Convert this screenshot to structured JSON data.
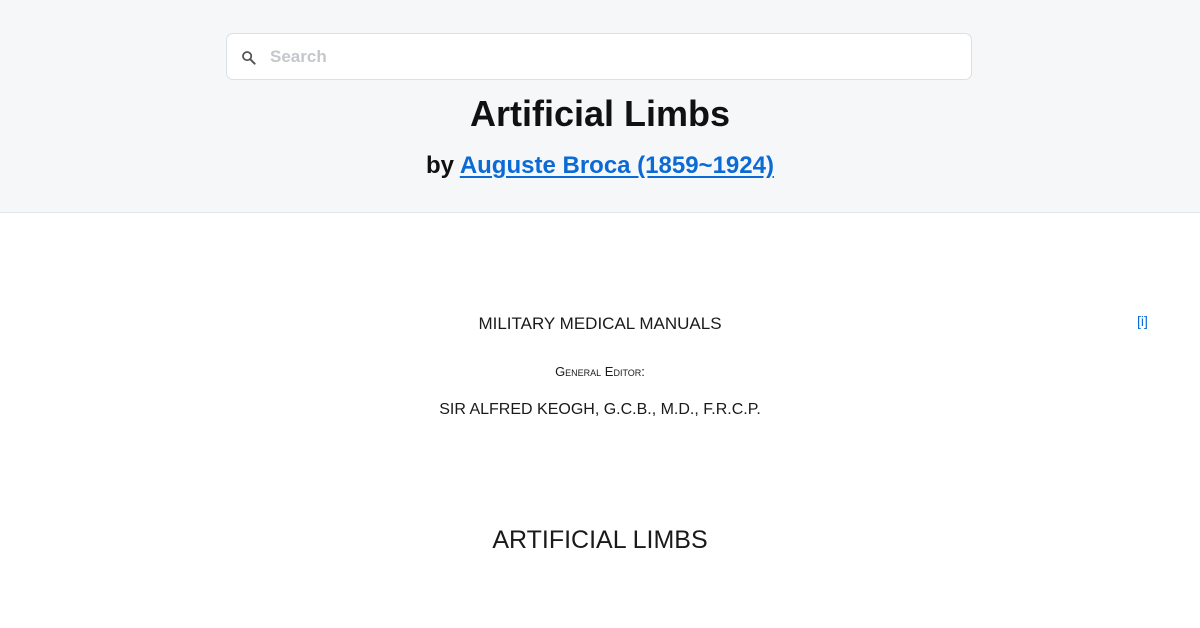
{
  "search": {
    "placeholder": "Search",
    "value": "",
    "icon": "search-icon"
  },
  "book": {
    "title": "Artificial Limbs",
    "by_prefix": "by ",
    "author": "Auguste Broca (1859~1924)"
  },
  "content": {
    "series_title": "MILITARY MEDICAL MANUALS",
    "editor_label": "General Editor:",
    "editor_name": "SIR ALFRED KEOGH, G.C.B., M.D., F.R.C.P.",
    "page_marker": "[i]",
    "section_heading": "ARTIFICIAL LIMBS"
  },
  "colors": {
    "header_bg": "#f6f7f9",
    "link": "#0a6ad6",
    "text": "#111111"
  }
}
